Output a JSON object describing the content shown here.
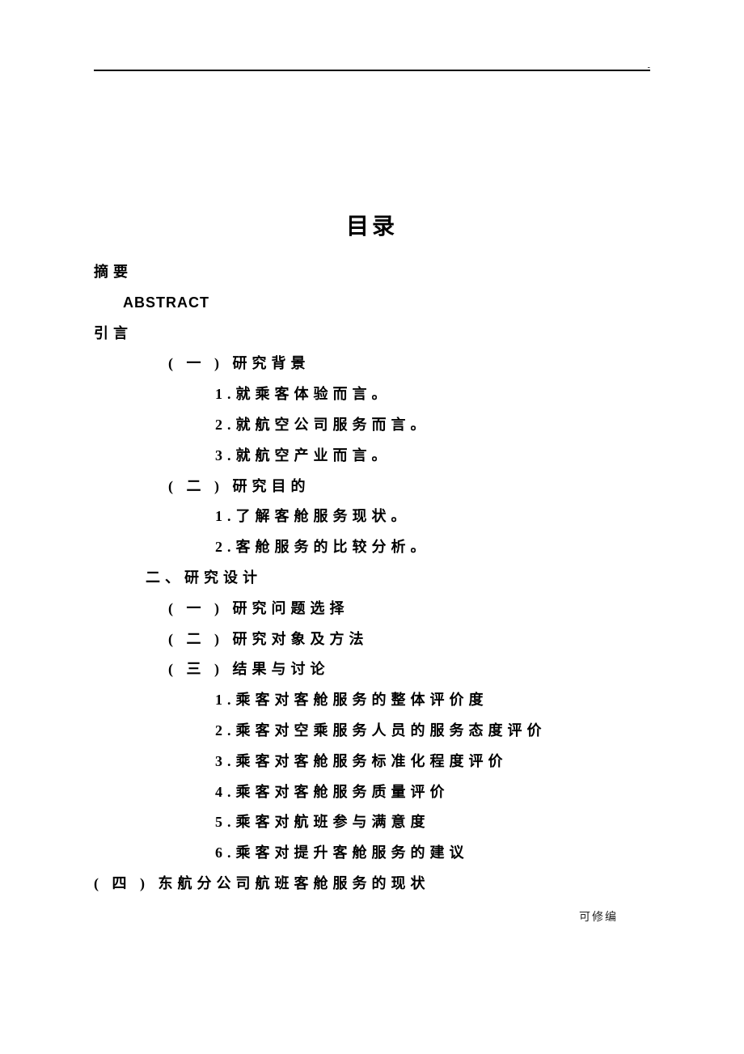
{
  "tiny_mark": "-",
  "title": "目录",
  "lines": [
    {
      "text": "摘要",
      "indent": "ind0"
    },
    {
      "text": "ABSTRACT",
      "indent": "ind1",
      "cls": "abstract-line"
    },
    {
      "text": "引言",
      "indent": "ind0"
    },
    {
      "text": "( 一 ) 研究背景",
      "indent": "ind2"
    },
    {
      "text": "1.就乘客体验而言。",
      "indent": "ind3"
    },
    {
      "text": "2.就航空公司服务而言。",
      "indent": "ind3"
    },
    {
      "text": "3.就航空产业而言。",
      "indent": "ind3"
    },
    {
      "text": "( 二 ) 研究目的",
      "indent": "ind2"
    },
    {
      "text": "1.了解客舱服务现状。",
      "indent": "ind3"
    },
    {
      "text": "2.客舱服务的比较分析。",
      "indent": "ind3"
    },
    {
      "text": "二、研究设计",
      "indent": "section-line"
    },
    {
      "text": "( 一 ) 研究问题选择",
      "indent": "ind2"
    },
    {
      "text": "( 二 ) 研究对象及方法",
      "indent": "ind2"
    },
    {
      "text": "( 三 ) 结果与讨论",
      "indent": "ind2"
    },
    {
      "text": "1.乘客对客舱服务的整体评价度",
      "indent": "ind3"
    },
    {
      "text": "2.乘客对空乘服务人员的服务态度评价",
      "indent": "ind3"
    },
    {
      "text": "3.乘客对客舱服务标准化程度评价",
      "indent": "ind3"
    },
    {
      "text": "4.乘客对客舱服务质量评价",
      "indent": "ind3"
    },
    {
      "text": "5.乘客对航班参与满意度",
      "indent": "ind3"
    },
    {
      "text": "6.乘客对提升客舱服务的建议",
      "indent": "ind3"
    },
    {
      "text": "( 四 ) 东航分公司航班客舱服务的现状",
      "indent": "ind0"
    }
  ],
  "footer": "可修编"
}
